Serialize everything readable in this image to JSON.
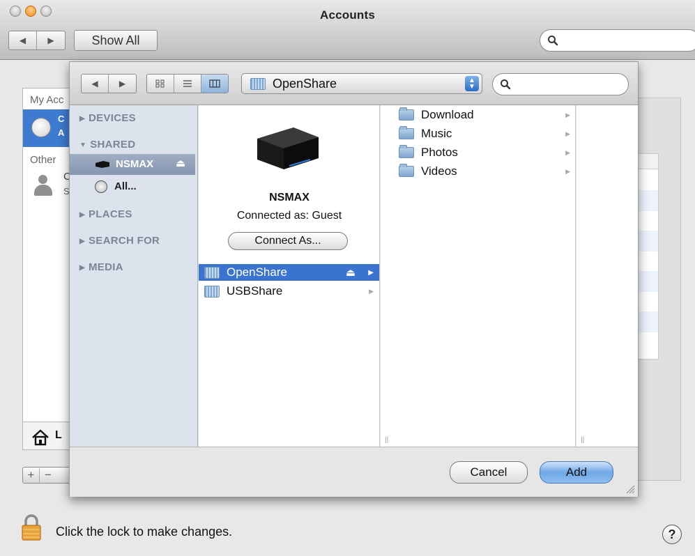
{
  "window": {
    "title": "Accounts"
  },
  "toolbar": {
    "show_all": "Show All",
    "search_placeholder": ""
  },
  "background": {
    "my_accounts": "My Acc",
    "other": "Other",
    "account_row_letters": [
      "C",
      "A"
    ],
    "other_row_letters": [
      "C",
      "S"
    ],
    "login_letter": "L"
  },
  "sheet": {
    "path_popup": "OpenShare",
    "search_placeholder": "",
    "sidebar": {
      "devices": "DEVICES",
      "shared": "SHARED",
      "shared_items": [
        "NSMAX",
        "All..."
      ],
      "places": "PLACES",
      "search_for": "SEARCH FOR",
      "media": "MEDIA"
    },
    "server": {
      "name": "NSMAX",
      "connected_as": "Connected as: Guest",
      "connect_button": "Connect As..."
    },
    "shares": [
      "OpenShare",
      "USBShare"
    ],
    "folders": [
      "Download",
      "Music",
      "Photos",
      "Videos"
    ],
    "cancel": "Cancel",
    "add": "Add"
  },
  "lock": {
    "text": "Click the lock to make changes."
  },
  "help": "?"
}
